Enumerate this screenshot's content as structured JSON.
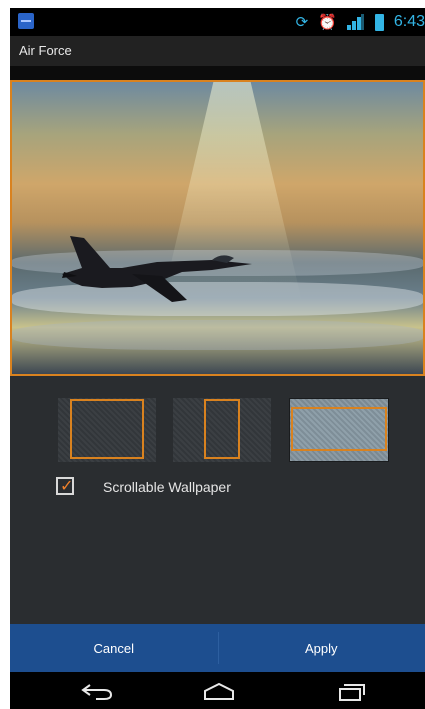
{
  "status_bar": {
    "time": "6:43",
    "icons": [
      "app-notification-icon",
      "sync-icon",
      "alarm-icon",
      "signal-icon",
      "battery-icon"
    ]
  },
  "title_bar": {
    "title": "Air Force"
  },
  "preview": {
    "image": "fighter-jet-sunset-wallpaper"
  },
  "thumbnails": [
    {
      "name": "crop-left",
      "selected": false
    },
    {
      "name": "crop-center",
      "selected": false
    },
    {
      "name": "crop-wide",
      "selected": true
    }
  ],
  "options": {
    "scrollable_label": "Scrollable Wallpaper",
    "scrollable_checked": true
  },
  "buttons": {
    "cancel": "Cancel",
    "apply": "Apply"
  },
  "nav": {
    "back": "back-icon",
    "home": "home-icon",
    "recents": "recents-icon"
  },
  "colors": {
    "accent": "#d9821f",
    "button_bar": "#1d4e8f",
    "status_icons": "#33b5e5"
  }
}
